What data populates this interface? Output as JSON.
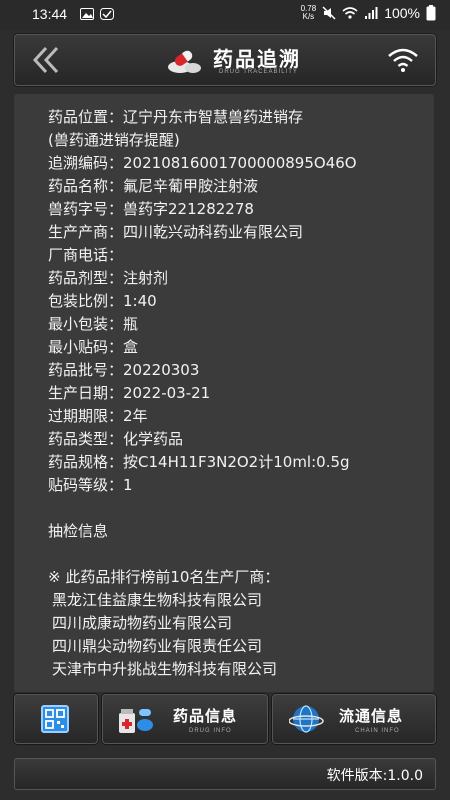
{
  "status_bar": {
    "time": "13:44",
    "net_speed_value": "0.78",
    "net_speed_unit": "K/s",
    "battery": "100%"
  },
  "header": {
    "title": "药品追溯",
    "subtitle": "DRUG TRACEABILITY"
  },
  "details": [
    {
      "label": "药品位置：",
      "value": "辽宁丹东市智慧兽药进销存"
    },
    {
      "label": "",
      "value": "(兽药通进销存提醒)"
    },
    {
      "label": "追溯编码：",
      "value": "20210816001700000895O46O"
    },
    {
      "label": "药品名称：",
      "value": "氟尼辛葡甲胺注射液"
    },
    {
      "label": "兽药字号：",
      "value": "兽药字221282278"
    },
    {
      "label": "生产产商：",
      "value": "四川乾兴动科药业有限公司"
    },
    {
      "label": "厂商电话：",
      "value": ""
    },
    {
      "label": "药品剂型：",
      "value": "注射剂"
    },
    {
      "label": "包装比例：",
      "value": "1:40"
    },
    {
      "label": "最小包装：",
      "value": "瓶"
    },
    {
      "label": "最小贴码：",
      "value": "盒"
    },
    {
      "label": "药品批号：",
      "value": "20220303"
    },
    {
      "label": "生产日期：",
      "value": "2022-03-21"
    },
    {
      "label": "过期期限：",
      "value": "2年"
    },
    {
      "label": "药品类型：",
      "value": "化学药品"
    },
    {
      "label": "药品规格：",
      "value": "按C14H11F3N2O2计10ml:0.5g"
    },
    {
      "label": "贴码等级：",
      "value": "1"
    }
  ],
  "inspection": {
    "title": "抽检信息"
  },
  "ranking": {
    "title": "※ 此药品排行榜前10名生产厂商：",
    "manufacturers": [
      "黑龙江佳益康生物科技有限公司",
      "四川成康动物药业有限公司",
      "四川鼎尖动物药业有限责任公司",
      "天津市中升挑战生物科技有限公司"
    ]
  },
  "tabs": {
    "drug": {
      "label": "药品信息",
      "sub": "DRUG INFO"
    },
    "chain": {
      "label": "流通信息",
      "sub": "CHAIN INFO"
    }
  },
  "footer": {
    "version": "软件版本:1.0.0"
  },
  "icons": {
    "back": "chevron-double-left-icon",
    "wifi": "wifi-icon",
    "qr": "qr-code-icon",
    "drug": "medicine-icon",
    "chain": "globe-icon"
  },
  "colors": {
    "background": "#2d2d2d",
    "panel": "#3b3b3b",
    "accent": "#2e8ee6"
  }
}
